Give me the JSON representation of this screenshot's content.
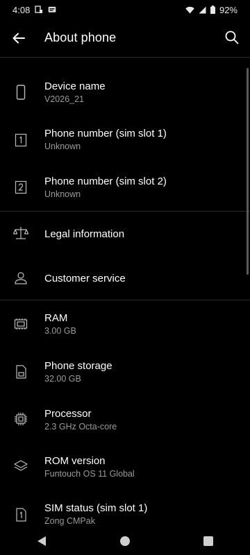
{
  "status_bar": {
    "time": "4:08",
    "battery_percent": "92%",
    "icons": [
      "sim-icon",
      "message-icon",
      "wifi-icon",
      "signal-icon",
      "battery-icon"
    ]
  },
  "app_bar": {
    "title": "About phone",
    "back_icon": "arrow-left-icon",
    "search_icon": "search-icon"
  },
  "items": [
    {
      "label": "Device name",
      "value": "V2026_21",
      "icon": "phone-icon"
    },
    {
      "label": "Phone number (sim slot 1)",
      "value": "Unknown",
      "icon": "sim-slot-1-icon"
    },
    {
      "label": "Phone number (sim slot 2)",
      "value": "Unknown",
      "icon": "sim-slot-2-icon"
    },
    {
      "label": "Legal information",
      "icon": "scale-icon"
    },
    {
      "label": "Customer service",
      "icon": "person-icon"
    },
    {
      "label": "RAM",
      "value": "3.00 GB",
      "icon": "memory-icon"
    },
    {
      "label": "Phone storage",
      "value": "32.00 GB",
      "icon": "storage-icon"
    },
    {
      "label": "Processor",
      "value": "2.3 GHz Octa-core",
      "icon": "processor-icon"
    },
    {
      "label": "ROM version",
      "value": "Funtouch OS 11 Global",
      "icon": "layers-icon"
    },
    {
      "label": "SIM status (sim slot 1)",
      "value": "Zong CMPak",
      "icon": "sim-card-1-icon"
    }
  ],
  "nav_bar": {
    "buttons": [
      "back-icon",
      "home-icon",
      "recents-icon"
    ]
  }
}
